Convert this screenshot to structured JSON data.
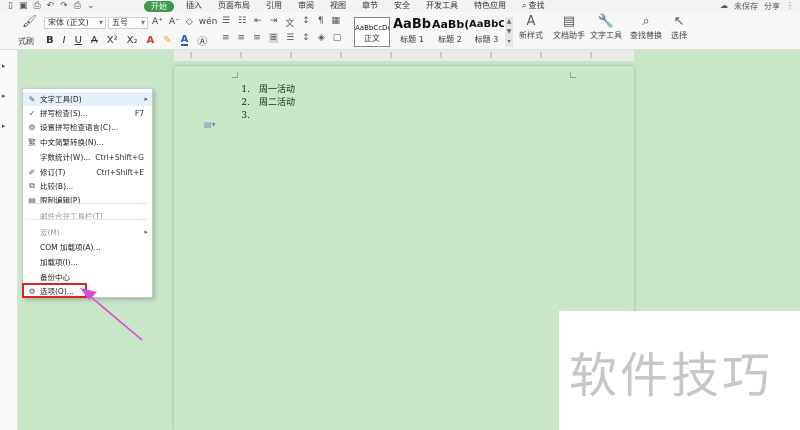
{
  "menubar": {
    "tabs": [
      "开始",
      "插入",
      "页面布局",
      "引用",
      "审阅",
      "视图",
      "章节",
      "安全",
      "开发工具",
      "特色应用"
    ],
    "search": "查找",
    "unsaved": "未保存",
    "share": "分享"
  },
  "ribbon": {
    "brush_label": "式刷",
    "font_name": "宋体 (正文)",
    "font_size": "五号",
    "styles": [
      {
        "sample": "AaBbCcDd",
        "name": "正文"
      },
      {
        "sample": "AaBb",
        "name": "标题 1"
      },
      {
        "sample": "AaBb(",
        "name": "标题 2"
      },
      {
        "sample": "AaBbC",
        "name": "标题 3"
      }
    ],
    "new_style": "新样式",
    "doc_helper": "文档助手",
    "text_tools": "文字工具",
    "find_replace": "查找替换",
    "select": "选择"
  },
  "document": {
    "list_items": [
      {
        "num": "1.",
        "text": "周一活动"
      },
      {
        "num": "2.",
        "text": "周二活动"
      },
      {
        "num": "3.",
        "text": ""
      }
    ]
  },
  "context_menu": {
    "items": [
      {
        "label": "文字工具(D)",
        "shortcut": "",
        "submenu": true,
        "icon": "text-tools-icon",
        "glyph": "✎",
        "state": "hover"
      },
      {
        "label": "拼写检查(S)...",
        "shortcut": "F7",
        "icon": "spellcheck-icon",
        "glyph": "✓"
      },
      {
        "label": "设置拼写检查语言(C)...",
        "shortcut": "",
        "icon": "language-icon",
        "glyph": "⚙"
      },
      {
        "label": "中文简繁转换(N)...",
        "shortcut": "",
        "icon": "convert-icon",
        "glyph": "繁"
      },
      {
        "label": "字数统计(W)...",
        "shortcut": "Ctrl+Shift+G",
        "icon": "",
        "glyph": ""
      },
      {
        "label": "修订(T)",
        "shortcut": "Ctrl+Shift+E",
        "icon": "revise-icon",
        "glyph": "✐"
      },
      {
        "label": "比较(B)...",
        "shortcut": "",
        "icon": "compare-icon",
        "glyph": "⧉"
      },
      {
        "label": "限制编辑(P)",
        "shortcut": "",
        "icon": "restrict-icon",
        "glyph": "▤"
      },
      {
        "label": "邮件合并工具栏(T)",
        "shortcut": "",
        "icon": "",
        "glyph": "",
        "state": "disabled"
      },
      {
        "label": "宏(M)",
        "shortcut": "",
        "submenu": true,
        "icon": "",
        "glyph": "",
        "state": "disabled"
      },
      {
        "label": "COM 加载项(A)...",
        "shortcut": "",
        "icon": "",
        "glyph": ""
      },
      {
        "label": "加载项(I)...",
        "shortcut": "",
        "icon": "",
        "glyph": ""
      },
      {
        "label": "备份中心",
        "shortcut": "",
        "icon": "",
        "glyph": ""
      },
      {
        "label": "选项(O)...",
        "shortcut": "",
        "icon": "options-gear-icon",
        "glyph": "⚙"
      }
    ]
  },
  "watermark": "软件技巧",
  "colors": {
    "accent": "#3a9b4a",
    "page_bg": "#c8e8c8",
    "highlight": "#e02020",
    "arrow": "#d64fd6"
  }
}
